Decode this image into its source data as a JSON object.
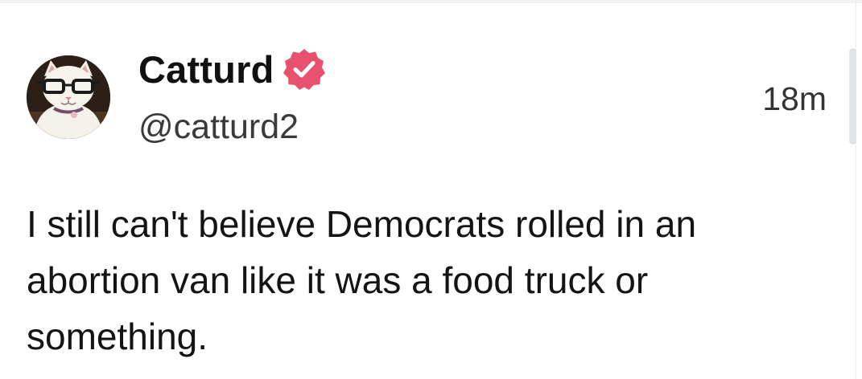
{
  "post": {
    "author": {
      "display_name": "Catturd",
      "handle": "@catturd2",
      "verified": true,
      "avatar_icon": "cat-with-glasses-avatar"
    },
    "timestamp": "18m",
    "text": "I still can't believe Democrats rolled in an abortion van like it was a food truck or something."
  },
  "colors": {
    "verified_badge": "#e8516e",
    "text": "#141414",
    "secondary_text": "#3a3a3a",
    "scrollbar": "#dfe3ea"
  }
}
